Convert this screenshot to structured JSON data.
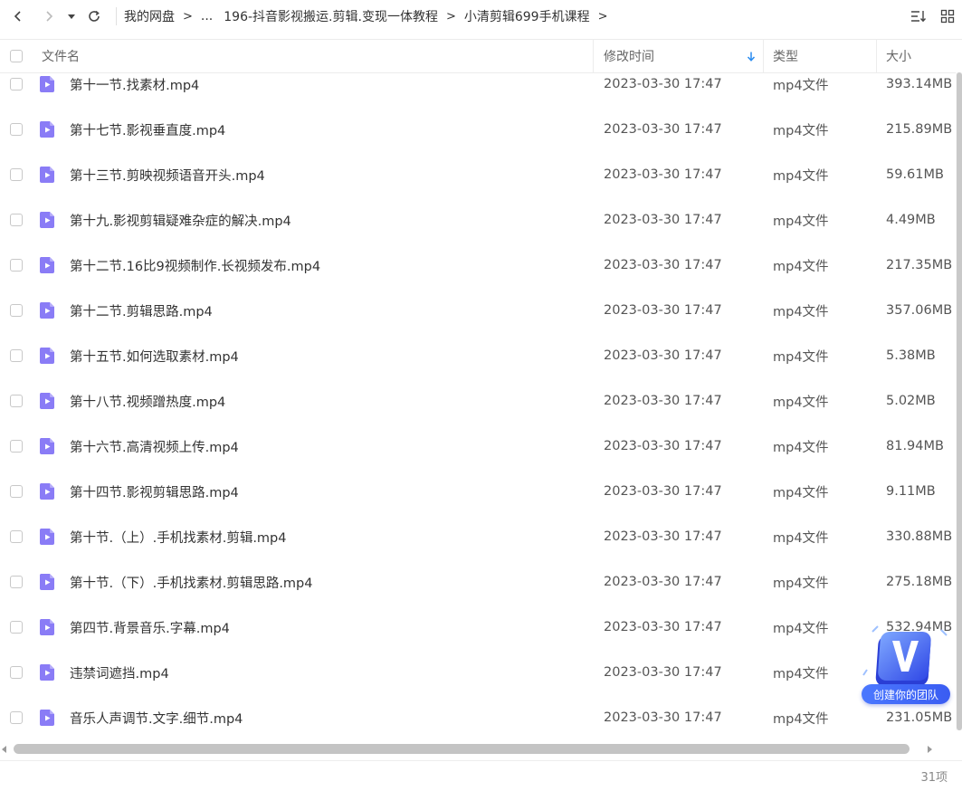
{
  "toolbar": {
    "breadcrumbs": [
      {
        "label": "我的网盘"
      },
      {
        "label": "..."
      },
      {
        "label": "196-抖音影视搬运.剪辑.变现一体教程"
      },
      {
        "label": "小清剪辑699手机课程"
      }
    ],
    "crumb_separator": ">",
    "icons": {
      "back": "chevron-left-icon",
      "forward": "chevron-right-icon",
      "history": "caret-down-icon",
      "refresh": "refresh-icon",
      "sort": "sort-icon",
      "view": "grid-view-icon"
    }
  },
  "header": {
    "name": "文件名",
    "modified": "修改时间",
    "type": "类型",
    "size": "大小",
    "sort_icon": "sort-down-arrow-icon"
  },
  "files": [
    {
      "name": "第十一节.找素材.mp4",
      "date": "2023-03-30 17:47",
      "type": "mp4文件",
      "size": "393.14MB"
    },
    {
      "name": "第十七节.影视垂直度.mp4",
      "date": "2023-03-30 17:47",
      "type": "mp4文件",
      "size": "215.89MB"
    },
    {
      "name": "第十三节.剪映视频语音开头.mp4",
      "date": "2023-03-30 17:47",
      "type": "mp4文件",
      "size": "59.61MB"
    },
    {
      "name": "第十九.影视剪辑疑难杂症的解决.mp4",
      "date": "2023-03-30 17:47",
      "type": "mp4文件",
      "size": "4.49MB"
    },
    {
      "name": "第十二节.16比9视频制作.长视频发布.mp4",
      "date": "2023-03-30 17:47",
      "type": "mp4文件",
      "size": "217.35MB"
    },
    {
      "name": "第十二节.剪辑思路.mp4",
      "date": "2023-03-30 17:47",
      "type": "mp4文件",
      "size": "357.06MB"
    },
    {
      "name": "第十五节.如何选取素材.mp4",
      "date": "2023-03-30 17:47",
      "type": "mp4文件",
      "size": "5.38MB"
    },
    {
      "name": "第十八节.视频蹭热度.mp4",
      "date": "2023-03-30 17:47",
      "type": "mp4文件",
      "size": "5.02MB"
    },
    {
      "name": "第十六节.高清视频上传.mp4",
      "date": "2023-03-30 17:47",
      "type": "mp4文件",
      "size": "81.94MB"
    },
    {
      "name": "第十四节.影视剪辑思路.mp4",
      "date": "2023-03-30 17:47",
      "type": "mp4文件",
      "size": "9.11MB"
    },
    {
      "name": "第十节.（上）.手机找素材.剪辑.mp4",
      "date": "2023-03-30 17:47",
      "type": "mp4文件",
      "size": "330.88MB"
    },
    {
      "name": "第十节.（下）.手机找素材.剪辑思路.mp4",
      "date": "2023-03-30 17:47",
      "type": "mp4文件",
      "size": "275.18MB"
    },
    {
      "name": "第四节.背景音乐.字幕.mp4",
      "date": "2023-03-30 17:47",
      "type": "mp4文件",
      "size": "532.94MB"
    },
    {
      "name": "违禁词遮挡.mp4",
      "date": "2023-03-30 17:47",
      "type": "mp4文件",
      "size": ""
    },
    {
      "name": "音乐人声调节.文字.细节.mp4",
      "date": "2023-03-30 17:47",
      "type": "mp4文件",
      "size": "231.05MB"
    }
  ],
  "file_icon": "video-file-icon",
  "status": {
    "count": "31项"
  },
  "promo": {
    "label": "创建你的团队",
    "logo_letter": "V"
  }
}
